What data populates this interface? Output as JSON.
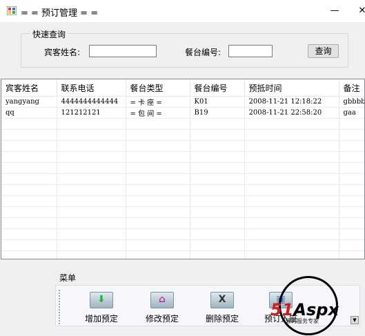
{
  "window": {
    "title": "= = 预订管理 = =",
    "minimize_glyph": "—",
    "close_glyph": "✕"
  },
  "search": {
    "group_label": "快速查询",
    "guest_name_label": "宾客姓名:",
    "guest_name_value": "",
    "table_no_label": "餐台编号:",
    "table_no_value": "",
    "query_button": "查询"
  },
  "grid": {
    "columns": [
      "宾客姓名",
      "联系电话",
      "餐台类型",
      "餐台编号",
      "预抵时间",
      "备注"
    ],
    "rows": [
      [
        "yangyang",
        "4444444444444",
        "= 卡 座 =",
        "K01",
        "2008-11-21 12:18:22",
        "gbbbbb"
      ],
      [
        "qq",
        "121212121",
        "= 包 间 =",
        "B19",
        "2008-11-21 22:58:20",
        "gaa"
      ]
    ]
  },
  "menu": {
    "group_label": "菜单",
    "tools": [
      {
        "label": "增加预定",
        "icon": "add-arrow-icon",
        "color": "#2bb34a"
      },
      {
        "label": "修改预定",
        "icon": "edit-house-icon",
        "color": "#b23aa8"
      },
      {
        "label": "删除预定",
        "icon": "delete-x-icon",
        "color": "#333333"
      },
      {
        "label": "预订入座",
        "icon": "seat-icon",
        "color": "#3b6fb6"
      }
    ]
  },
  "watermark": {
    "brand_red": "51",
    "brand_black": "Aspx",
    "tagline": "源码服务专家"
  }
}
